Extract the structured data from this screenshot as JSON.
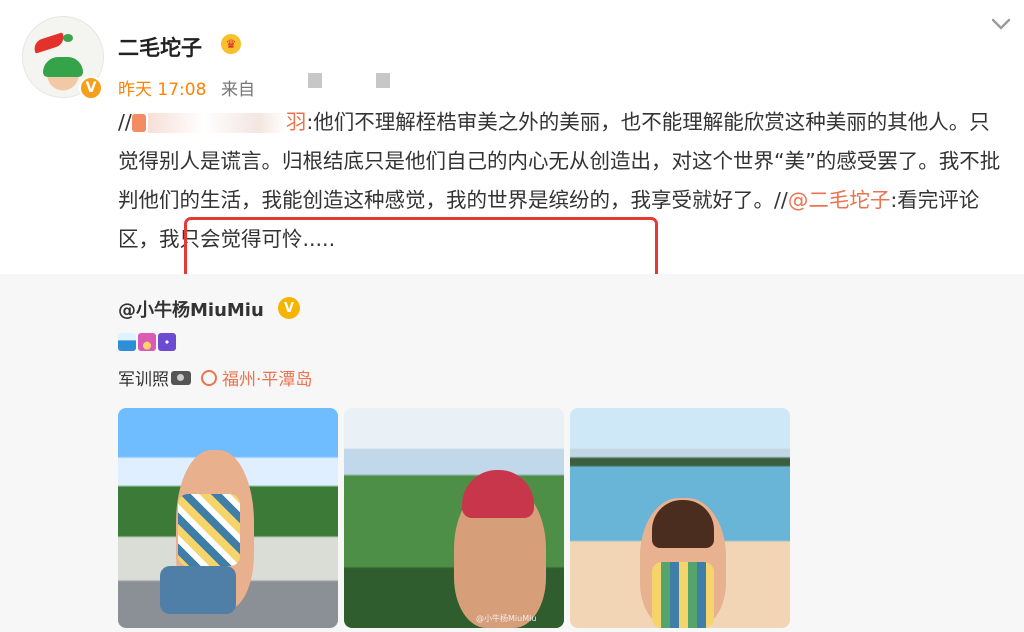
{
  "post": {
    "username": "二毛坨子",
    "time": "昨天 17:08",
    "source": "来自",
    "repost": {
      "prefix": "//",
      "suffix_name": "羽",
      "text_1": ":他们不理解桎梏审美之外的美丽，也不能理解能欣赏这种美丽的其他人。只觉得别人是谎言。归根结底只是他们自己的内心无从创造出，对这个世界“美”的感受罢了。我不批判他们的生活，我能创造这种感觉，我的世界是缤纷的，我享受就好了。",
      "mention_prefix": "//",
      "mention": "@二毛坨子",
      "text_2": ":看完评论区，我只会觉得可怜....."
    }
  },
  "original": {
    "author": "@小牛杨MiuMiu",
    "caption": "军训照",
    "location": "福州·平潭岛",
    "photo_watermark": "@小牛杨MiuMiu"
  },
  "icons": {
    "collapse": "chevron-down-icon",
    "badge": "verified-badge",
    "crown": "crown-icon",
    "camera": "camera-icon",
    "location": "location-icon"
  },
  "colors": {
    "orange": "#ff8200",
    "link": "#eb7350",
    "highlight": "#e53935",
    "background": "#f7f7f7"
  }
}
